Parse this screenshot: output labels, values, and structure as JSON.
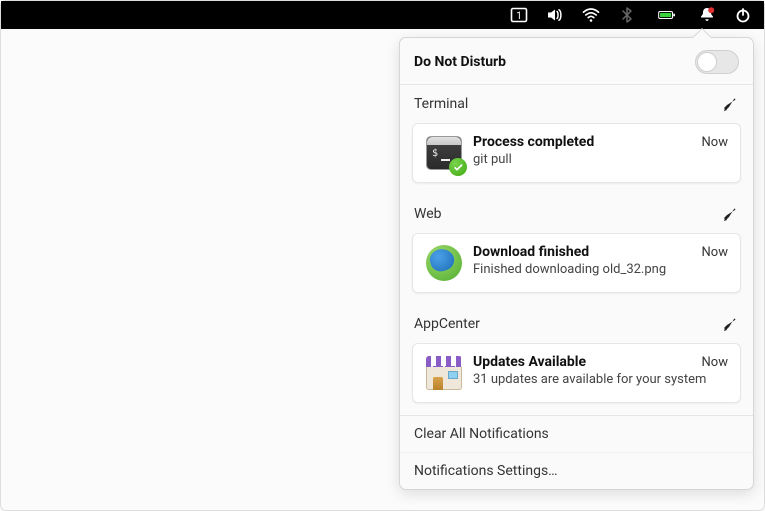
{
  "dnd": {
    "label": "Do Not Disturb",
    "on": false
  },
  "tray": {
    "workspace": "1"
  },
  "sections": [
    {
      "title": "Terminal",
      "icon": "terminal",
      "notif": {
        "title": "Process completed",
        "body": "git pull",
        "time": "Now"
      }
    },
    {
      "title": "Web",
      "icon": "web",
      "notif": {
        "title": "Download finished",
        "body": "Finished downloading old_32.png",
        "time": "Now"
      }
    },
    {
      "title": "AppCenter",
      "icon": "store",
      "notif": {
        "title": "Updates Available",
        "body": "31 updates are available for your system",
        "time": "Now"
      }
    }
  ],
  "footer": {
    "clear": "Clear All Notifications",
    "settings": "Notifications Settings…"
  }
}
